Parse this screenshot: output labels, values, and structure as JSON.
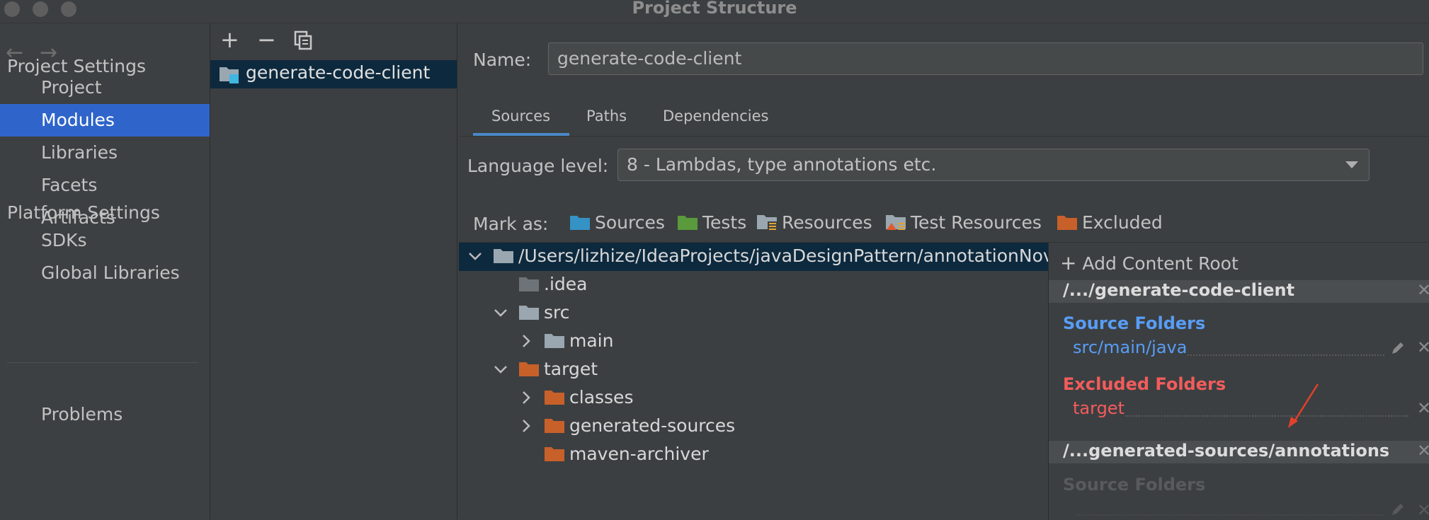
{
  "window": {
    "title": "Project Structure"
  },
  "sidebar": {
    "project_settings": "Project Settings",
    "project_items": [
      "Project",
      "Modules",
      "Libraries",
      "Facets",
      "Artifacts"
    ],
    "platform_settings": "Platform Settings",
    "platform_items": [
      "SDKs",
      "Global Libraries"
    ],
    "problems": "Problems",
    "active": "Modules"
  },
  "module_list": {
    "selected": "generate-code-client"
  },
  "module_editor": {
    "name_label": "Name:",
    "name_value": "generate-code-client",
    "tabs": [
      "Sources",
      "Paths",
      "Dependencies"
    ],
    "active_tab": "Sources",
    "language_level_label": "Language level:",
    "language_level_value": "8 - Lambdas, type annotations etc.",
    "mark_as_label": "Mark as:",
    "mark_as": [
      "Sources",
      "Tests",
      "Resources",
      "Test Resources",
      "Excluded"
    ]
  },
  "tree": {
    "root": "/Users/lizhize/IdeaProjects/javaDesignPattern/annotationNov",
    "nodes": [
      ".idea",
      "src",
      "main",
      "target",
      "classes",
      "generated-sources",
      "maven-archiver"
    ]
  },
  "content_roots": {
    "add_label": "Add Content Root",
    "root1": {
      "path": "/.../generate-code-client",
      "source_heading": "Source Folders",
      "source_path": "src/main/java",
      "excluded_heading": "Excluded Folders",
      "excluded_path": "target"
    },
    "root2": {
      "path": "/...generated-sources/annotations",
      "source_heading": "Source Folders"
    }
  },
  "colors": {
    "accent": "#2f65ca",
    "sources": "#589df6",
    "excluded": "#f35c5c",
    "annotation_arrow": "#e2412c"
  }
}
